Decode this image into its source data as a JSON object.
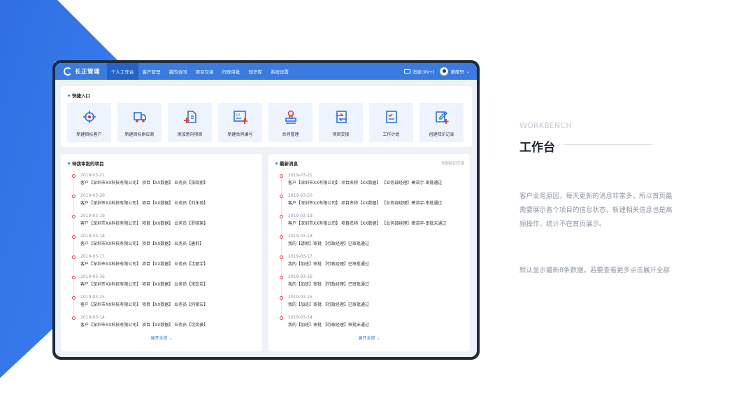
{
  "app": {
    "logo_text": "长正管理"
  },
  "nav": {
    "items": [
      {
        "label": "个人工作台",
        "active": true
      },
      {
        "label": "客户管理"
      },
      {
        "label": "我的合同"
      },
      {
        "label": "项目交接"
      },
      {
        "label": "行政审批"
      },
      {
        "label": "知识库"
      },
      {
        "label": "系统设置"
      }
    ],
    "messages": "消息(99+)",
    "user_name": "黄皓轩"
  },
  "quick": {
    "title": "快捷入口",
    "tiles": [
      {
        "label": "新建目标客户",
        "icon": "target-icon"
      },
      {
        "label": "新建目标供应商",
        "icon": "truck-icon"
      },
      {
        "label": "添加意向项目",
        "icon": "add-project-icon"
      },
      {
        "label": "新建合同编号",
        "icon": "contract-number-icon"
      },
      {
        "label": "合同管理",
        "icon": "stamp-icon"
      },
      {
        "label": "项目交接",
        "icon": "handover-icon"
      },
      {
        "label": "工作计划",
        "icon": "work-plan-icon"
      },
      {
        "label": "创建拜访记录",
        "icon": "visit-record-icon"
      }
    ]
  },
  "pending": {
    "title": "待我审批的项目",
    "expand": "展开全部",
    "items": [
      {
        "date": "2019-03-21",
        "text": "客户【深圳市XX科技有限公司】   项目【XX数据】   业务员【张晓丽】"
      },
      {
        "date": "2019-03-20",
        "text": "客户【深圳市XX科技有限公司】   项目【XX数据】   业务员【刘永琦】"
      },
      {
        "date": "2019-03-19",
        "text": "客户【深圳市XX科技有限公司】   项目【XX数据】   业务员【罗晓瑜】"
      },
      {
        "date": "2019-03-18",
        "text": "客户【深圳市XX科技有限公司】   项目【XX数据】   业务员【唐莉】"
      },
      {
        "date": "2019-03-17",
        "text": "客户【深圳市XX科技有限公司】   项目【XX数据】   业务员【沈丽宇】"
      },
      {
        "date": "2019-03-16",
        "text": "客户【深圳市XX科技有限公司】   项目【XX数据】   业务员【宋宏岩】"
      },
      {
        "date": "2019-03-15",
        "text": "客户【深圳市XX科技有限公司】   项目【XX数据】   业务员【何家宏】"
      },
      {
        "date": "2019-03-14",
        "text": "客户【深圳市XX科技有限公司】   项目【XX数据】   业务员【沈奕豪】"
      }
    ]
  },
  "news": {
    "title": "最新消息",
    "mark_read": "全部标记已读",
    "expand": "展开全部",
    "items": [
      {
        "date": "2019-03-21",
        "text": "客户【深圳市XX有限公司】   项目名称【XX数据】   【业务部经理】萧浩宇-审批通过"
      },
      {
        "date": "2019-03-20",
        "text": "客户【深圳市XX有限公司】   项目名称【XX数据】   【业务部经理】萧浩宇-审批通过"
      },
      {
        "date": "2019-03-19",
        "text": "客户【深圳市XX有限公司】   项目名称【XX数据】   【业务部经理】萧浩宇-审批未通过"
      },
      {
        "date": "2019-03-18",
        "text": "我的【请假】审批   【行政经理】已审批通过"
      },
      {
        "date": "2019-03-17",
        "text": "我的【加班】审批   【行政经理】已审批通过"
      },
      {
        "date": "2019-03-16",
        "text": "我的【加班】审批   【行政经理】已审批通过"
      },
      {
        "date": "2019-03-15",
        "text": "我的【加班】审批   【行政经理】已审批通过"
      },
      {
        "date": "2019-03-14",
        "text": "我的【加班】审批   【行政经理】审批未通过"
      }
    ]
  },
  "side": {
    "title_en": "WORKBENCH",
    "title_zh": "工作台",
    "desc": "客户业务原因，每天更新的消息非常多，所以首页最需要展示各个项目的信息状态，新建相关信息也是高频操作，统计不在首页展示。",
    "note": "默认显示最新8条数据，若要查看更多点击展开全部"
  },
  "colors": {
    "accent": "#3a7be0",
    "alert": "#e23b3b",
    "frame": "#1f2a3c"
  }
}
